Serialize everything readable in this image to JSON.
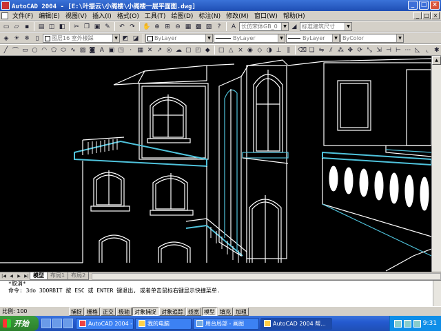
{
  "window": {
    "title": "AutoCAD 2004 - [E:\\叶振云\\小阁楼\\小阁楼一层平面图.dwg]",
    "controls": [
      "_",
      "□",
      "×"
    ]
  },
  "menu": {
    "items": [
      "文件(F)",
      "编辑(E)",
      "视图(V)",
      "插入(I)",
      "格式(O)",
      "工具(T)",
      "绘图(D)",
      "标注(N)",
      "修改(M)",
      "窗口(W)",
      "帮助(H)"
    ],
    "mdi_controls": [
      "_",
      "□",
      "×"
    ]
  },
  "toolbar1": {
    "text_style": "长仿宋体GB_0",
    "dim_style": "标准建筑尺寸"
  },
  "toolbar2": {
    "layer": "图层16 室外楼踩",
    "color": "ByLayer",
    "linetype": "ByLayer",
    "lineweight": "ByLayer",
    "plotstyle": "ByColor"
  },
  "tabs": {
    "nav": [
      "|◀",
      "◀",
      "▶",
      "▶|"
    ],
    "items": [
      "模型",
      "布局1",
      "布局2"
    ],
    "active": 0
  },
  "command": {
    "history": [
      "*取消*",
      "命令: 3do 3DORBIT 按 ESC 或 ENTER 键退出, 或者单击鼠标右键显示快捷菜单."
    ],
    "prompt": ""
  },
  "status": {
    "scale": "比例: 100",
    "toggles": [
      {
        "label": "捕捉",
        "on": false
      },
      {
        "label": "栅格",
        "on": false
      },
      {
        "label": "正交",
        "on": false
      },
      {
        "label": "极轴",
        "on": false
      },
      {
        "label": "对象捕捉",
        "on": true
      },
      {
        "label": "对象追踪",
        "on": false
      },
      {
        "label": "线宽",
        "on": false
      },
      {
        "label": "模型",
        "on": true
      },
      {
        "label": "填充",
        "on": false
      },
      {
        "label": "加粗",
        "on": false
      }
    ]
  },
  "taskbar": {
    "start": "开始",
    "tasks": [
      "AutoCAD 2004 - ...",
      "我的电脑",
      "用台局部 - 画图",
      "AutoCAD 2004 帮..."
    ],
    "active_task": 3,
    "clock": "9:31"
  },
  "colors": {
    "title_blue": "#1f4fb5",
    "canvas": "#000000",
    "cyan_edge": "#4fc3dc"
  }
}
